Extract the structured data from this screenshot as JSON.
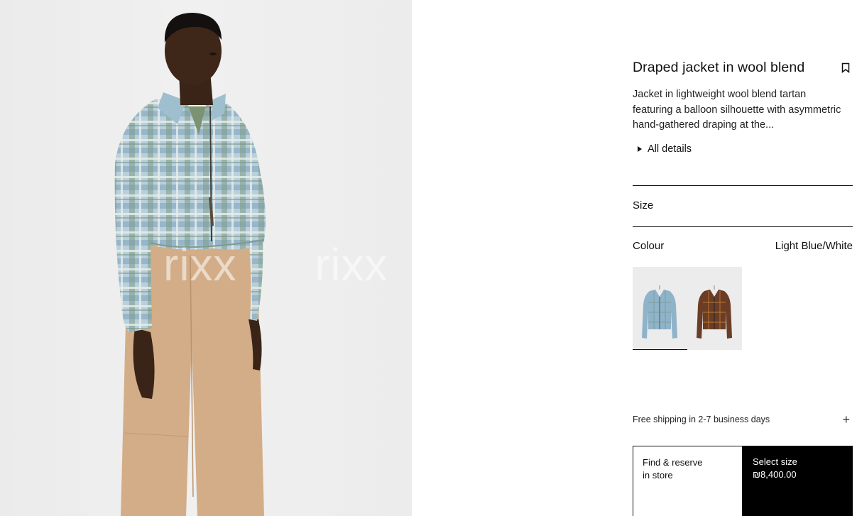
{
  "hero": {
    "watermark": [
      "rixx",
      "rixx"
    ],
    "alt": "Model wearing plaid cropped jacket and beige trousers"
  },
  "product": {
    "title": "Draped jacket in wool blend",
    "description": "Jacket in lightweight wool blend tartan featuring a balloon silhouette with asymmetric hand-gathered draping at the...",
    "all_details_label": "All details",
    "bookmark_icon": "bookmark-icon"
  },
  "size": {
    "label": "Size"
  },
  "colour": {
    "label": "Colour",
    "selected": "Light Blue/White",
    "swatches": [
      {
        "name": "Light Blue/White",
        "color": "#8fb3c9",
        "selected": true
      },
      {
        "name": "Brown check",
        "color": "#6b3d25",
        "selected": false
      }
    ]
  },
  "shipping": {
    "label": "Free shipping in 2-7 business days",
    "toggle_icon": "plus-icon"
  },
  "actions": {
    "store_line1": "Find & reserve",
    "store_line2": "in store",
    "size_line1": "Select size",
    "price": "₪8,400.00"
  }
}
